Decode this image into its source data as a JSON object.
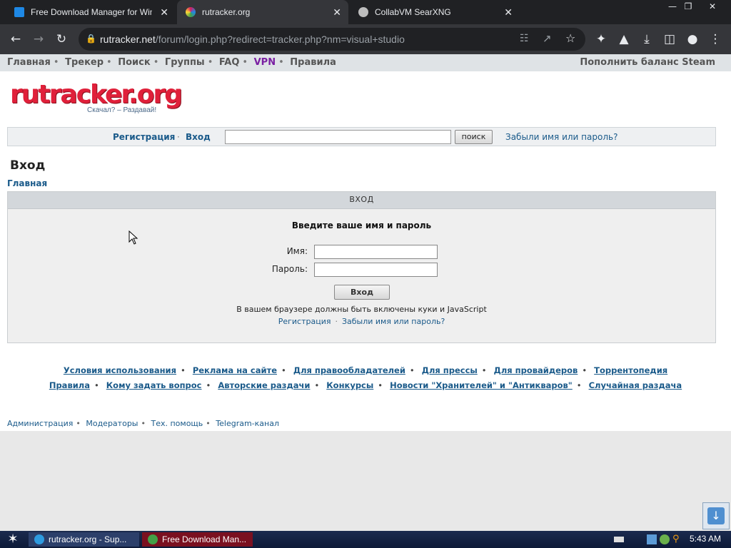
{
  "browser": {
    "tabs": [
      {
        "title": "Free Download Manager for Windows",
        "favicon_color": "#1e88e5",
        "active": false
      },
      {
        "title": "rutracker.org",
        "favicon_color": "#d81b60",
        "active": true
      },
      {
        "title": "CollabVM SearXNG",
        "favicon_color": "#bdbdbd",
        "active": false
      }
    ],
    "close_glyph": "✕",
    "url_domain": "rutracker.net",
    "url_path": "/forum/login.php?redirect=tracker.php?nm=visual+studio"
  },
  "site": {
    "topnav": [
      {
        "label": "Главная"
      },
      {
        "label": "Трекер"
      },
      {
        "label": "Поиск"
      },
      {
        "label": "Группы"
      },
      {
        "label": "FAQ"
      },
      {
        "label": "VPN"
      },
      {
        "label": "Правила"
      }
    ],
    "topnav_right": "Пополнить баланс Steam",
    "logo_text": "rutracker.org",
    "logo_tagline": "Скачал? – Раздавай!",
    "loginbar": {
      "register": "Регистрация",
      "login": "Вход",
      "search_button": "поиск",
      "forgot": "Забыли имя или пароль?"
    },
    "page_title": "Вход",
    "breadcrumb": "Главная",
    "panel": {
      "header": "ВХОД",
      "prompt": "Введите ваше имя и пароль",
      "name_label": "Имя:",
      "password_label": "Пароль:",
      "submit": "Вход",
      "cookies_note": "В вашем браузере должны быть включены куки и JavaScript",
      "register_link": "Регистрация",
      "forgot_link": "Забыли имя или пароль?"
    },
    "footer_row1": [
      "Условия использования",
      "Реклама на сайте",
      "Для правообладателей",
      "Для прессы",
      "Для провайдеров",
      "Торрентопедия"
    ],
    "footer_row2": [
      "Правила",
      "Кому задать вопрос",
      "Авторские раздачи",
      "Конкурсы",
      "Новости \"Хранителей\" и \"Антикваров\"",
      "Случайная раздача"
    ],
    "bottom_links": [
      "Администрация",
      "Модераторы",
      "Тех. помощь",
      "Telegram-канал"
    ]
  },
  "taskbar": {
    "items": [
      {
        "label": "rutracker.org - Sup...",
        "icon_color": "#2e9be0"
      },
      {
        "label": "Free Download Man...",
        "icon_color": "#43a047"
      }
    ],
    "clock": "5:43 AM"
  }
}
